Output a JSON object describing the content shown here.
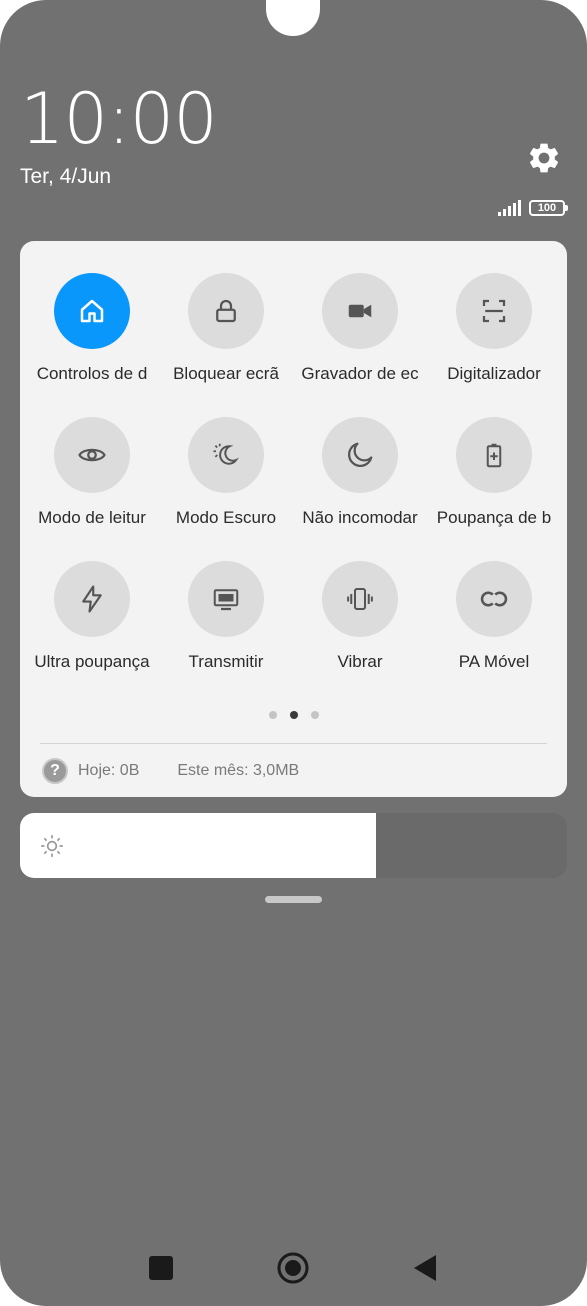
{
  "status": {
    "time": "10:00",
    "date": "Ter, 4/Jun",
    "battery": "100"
  },
  "tiles": [
    {
      "label": "Controlos de d",
      "icon": "home-icon",
      "active": true
    },
    {
      "label": "Bloquear ecrã",
      "icon": "lock-icon",
      "active": false
    },
    {
      "label": "Gravador de ec",
      "icon": "video-camera-icon",
      "active": false
    },
    {
      "label": "Digitalizador",
      "icon": "scan-icon",
      "active": false
    },
    {
      "label": "Modo de leitur",
      "icon": "eye-icon",
      "active": false
    },
    {
      "label": "Modo Escuro",
      "icon": "dark-mode-icon",
      "active": false
    },
    {
      "label": "Não incomodar",
      "icon": "moon-icon",
      "active": false
    },
    {
      "label": "Poupança de b",
      "icon": "battery-saver-icon",
      "active": false
    },
    {
      "label": "Ultra poupança",
      "icon": "lightning-icon",
      "active": false
    },
    {
      "label": "Transmitir",
      "icon": "cast-screen-icon",
      "active": false
    },
    {
      "label": "Vibrar",
      "icon": "vibrate-icon",
      "active": false
    },
    {
      "label": "PA Móvel",
      "icon": "hotspot-link-icon",
      "active": false
    }
  ],
  "pager": {
    "count": 3,
    "current": 2
  },
  "usage": {
    "help_symbol": "?",
    "today": "Hoje: 0B",
    "month": "Este mês: 3,0MB"
  },
  "brightness": {
    "level": 0.65
  },
  "colors": {
    "accent": "#0a97fb",
    "background": "#717171",
    "panel": "#f3f3f3"
  }
}
